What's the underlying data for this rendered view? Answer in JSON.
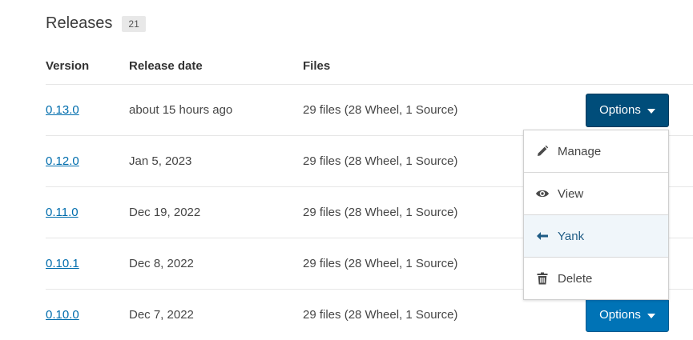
{
  "header": {
    "title": "Releases",
    "count": "21"
  },
  "table": {
    "columns": [
      "Version",
      "Release date",
      "Files"
    ],
    "rows": [
      {
        "version": "0.13.0",
        "date": "about 15 hours ago",
        "files": "29 files (28 Wheel, 1 Source)",
        "options_label": "Options"
      },
      {
        "version": "0.12.0",
        "date": "Jan 5, 2023",
        "files": "29 files (28 Wheel, 1 Source)"
      },
      {
        "version": "0.11.0",
        "date": "Dec 19, 2022",
        "files": "29 files (28 Wheel, 1 Source)"
      },
      {
        "version": "0.10.1",
        "date": "Dec 8, 2022",
        "files": "29 files (28 Wheel, 1 Source)"
      },
      {
        "version": "0.10.0",
        "date": "Dec 7, 2022",
        "files": "29 files (28 Wheel, 1 Source)",
        "options_label": "Options"
      }
    ]
  },
  "dropdown": {
    "items": [
      {
        "label": "Manage",
        "icon": "pencil-icon"
      },
      {
        "label": "View",
        "icon": "eye-icon"
      },
      {
        "label": "Yank",
        "icon": "arrow-left-icon"
      },
      {
        "label": "Delete",
        "icon": "trash-icon"
      }
    ]
  },
  "colors": {
    "link": "#006dad",
    "button": "#0073b6",
    "button_active": "#004d7a",
    "highlight": "#f0f6fa"
  }
}
